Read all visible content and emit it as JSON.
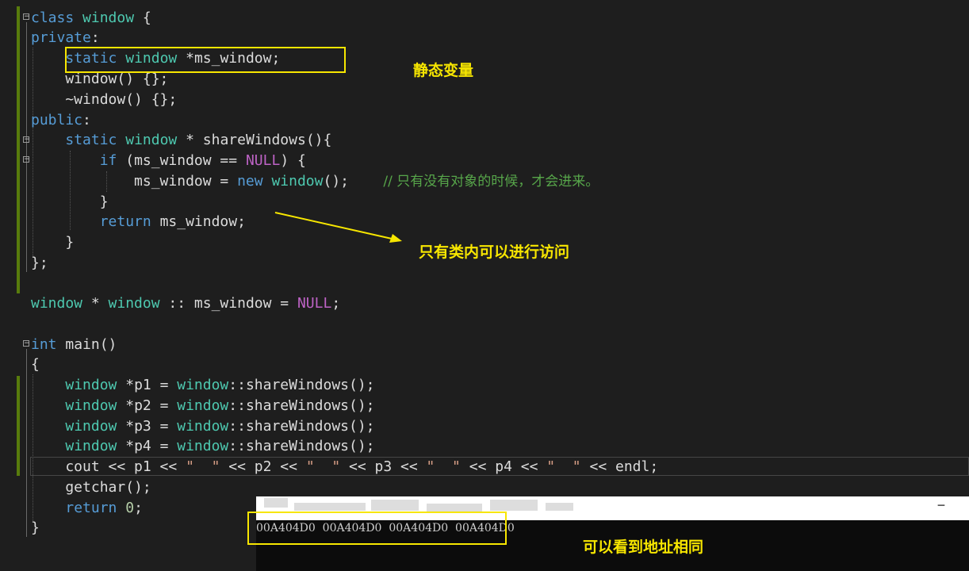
{
  "annotations": {
    "static_var": "静态变量",
    "class_only": "只有类内可以进行访问",
    "same_address": "可以看到地址相同"
  },
  "console": {
    "title_blurred": true,
    "output": "00A404D0  00A404D0  00A404D0  00A404D0"
  },
  "code_comment": "// 只有没有对象的时候，才会进来。",
  "colors": {
    "background": "#1e1e1e",
    "keyword": "#569cd6",
    "type": "#4ec9b0",
    "macro": "#bd63c5",
    "comment": "#57a64a",
    "annotation": "#f7e600",
    "change_bar": "#587c0c"
  },
  "icons": [
    "fold-toggle-icon",
    "minimize-icon"
  ]
}
